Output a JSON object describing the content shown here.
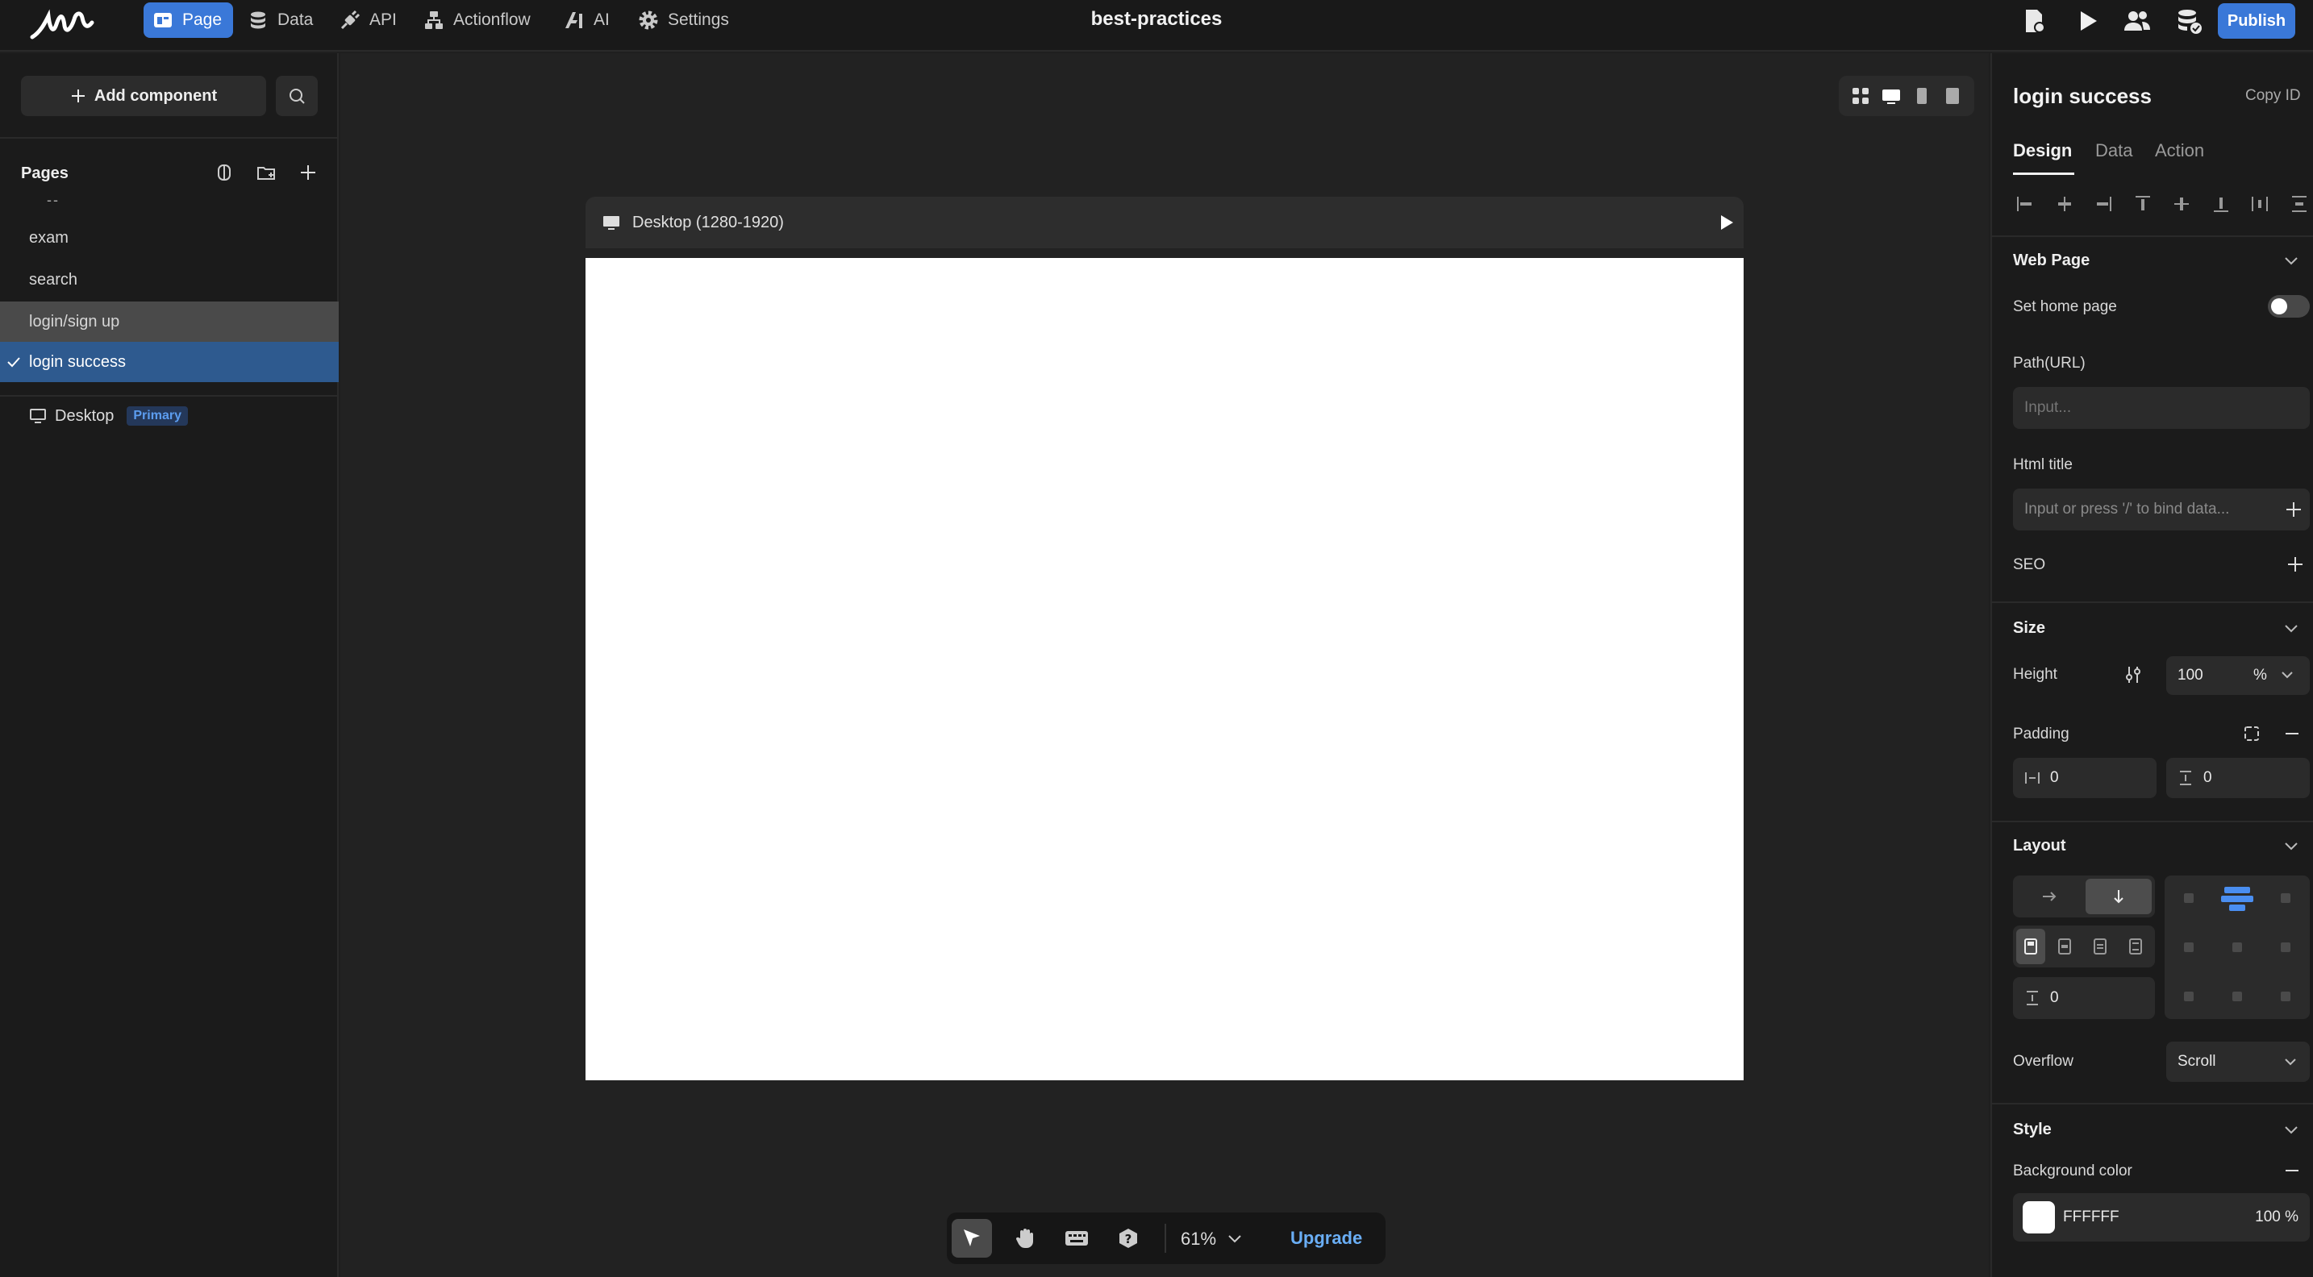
{
  "app": {
    "title": "best-practices",
    "nav": [
      {
        "label": "Page",
        "icon": "page-icon",
        "active": true
      },
      {
        "label": "Data",
        "icon": "database-icon"
      },
      {
        "label": "API",
        "icon": "plug-icon"
      },
      {
        "label": "Actionflow",
        "icon": "flow-icon"
      },
      {
        "label": "AI",
        "icon": "ai-icon"
      },
      {
        "label": "Settings",
        "icon": "gear-icon"
      }
    ],
    "actions": [
      "file-status-icon",
      "play-icon",
      "users-icon",
      "database-check-icon"
    ],
    "publish_label": "Publish",
    "accent": "#3a78d8"
  },
  "left": {
    "add_component_label": "Add component",
    "pages_title": "Pages",
    "dash": "--",
    "pages": [
      {
        "label": "exam"
      },
      {
        "label": "search"
      },
      {
        "label": "login/sign up",
        "state": "hover"
      },
      {
        "label": "login success",
        "state": "selected"
      }
    ],
    "device": {
      "label": "Desktop",
      "badge": "Primary"
    }
  },
  "canvas": {
    "frame_label": "Desktop (1280-1920)",
    "zoom": "61%",
    "upgrade_label": "Upgrade",
    "page_background": "#FFFFFF"
  },
  "right": {
    "title": "login success",
    "copy_id_label": "Copy ID",
    "tabs": [
      "Design",
      "Data",
      "Action"
    ],
    "active_tab": "Design",
    "web_page": {
      "title": "Web Page",
      "set_home_label": "Set home page",
      "set_home_on": false,
      "path_label": "Path(URL)",
      "path_placeholder": "Input...",
      "html_title_label": "Html title",
      "html_title_placeholder": "Input or press '/' to bind data...",
      "seo_label": "SEO"
    },
    "size": {
      "title": "Size",
      "height_label": "Height",
      "height_value": "100",
      "height_unit": "%",
      "padding_label": "Padding",
      "padding_h": "0",
      "padding_v": "0"
    },
    "layout": {
      "title": "Layout",
      "direction": "vertical",
      "gap": "0",
      "overflow_label": "Overflow",
      "overflow_value": "Scroll"
    },
    "style": {
      "title": "Style",
      "bg_label": "Background color",
      "bg_hex": "FFFFFF",
      "bg_opacity": "100 %"
    }
  }
}
